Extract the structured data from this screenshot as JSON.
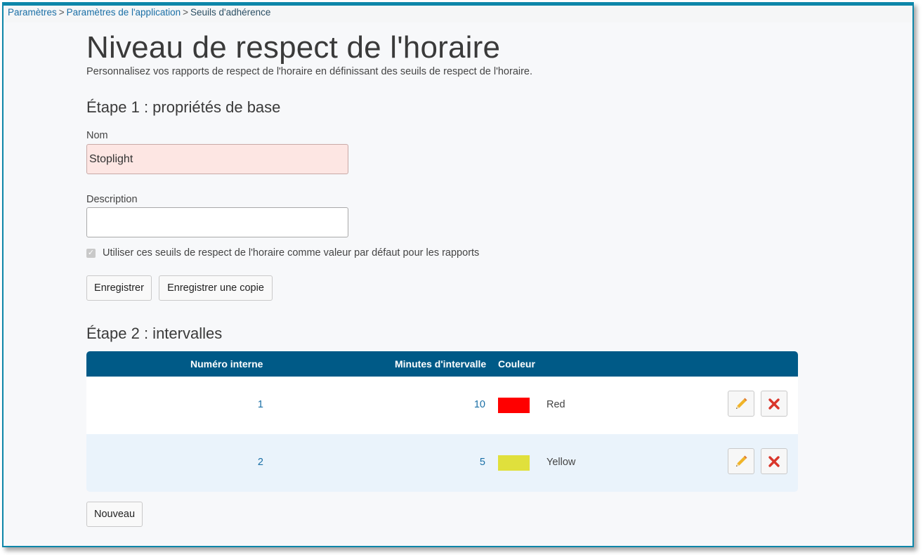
{
  "breadcrumb": {
    "item1": "Paramètres",
    "sep": ">",
    "item2": "Paramètres de l'application",
    "current": "Seuils d'adhérence"
  },
  "page": {
    "title": "Niveau de respect de l'horaire",
    "subtitle": "Personnalisez vos rapports de respect de l'horaire en définissant des seuils de respect de l'horaire."
  },
  "step1": {
    "heading": "Étape 1 : propriétés de base",
    "name_label": "Nom",
    "name_value": "Stoplight",
    "description_label": "Description",
    "description_value": "",
    "default_checkbox_label": "Utiliser ces seuils de respect de l'horaire comme valeur par défaut pour les rapports",
    "default_checked": true,
    "save_label": "Enregistrer",
    "save_copy_label": "Enregistrer une copie"
  },
  "step2": {
    "heading": "Étape 2 : intervalles",
    "columns": {
      "internal_number": "Numéro interne",
      "interval_minutes": "Minutes d'intervalle",
      "color": "Couleur"
    },
    "rows": [
      {
        "internal_number": "1",
        "interval_minutes": "10",
        "color_hex": "#ff0000",
        "color_name": "Red"
      },
      {
        "internal_number": "2",
        "interval_minutes": "5",
        "color_hex": "#e0e03c",
        "color_name": "Yellow"
      }
    ],
    "new_label": "Nouveau"
  },
  "colors": {
    "header": "#005a87",
    "link": "#1a6fa6",
    "frame_border": "#0d86a9",
    "edit_icon": "#f0b428",
    "delete_icon": "#d9362b"
  },
  "icons": {
    "edit": "pencil-icon",
    "delete": "close-icon"
  }
}
